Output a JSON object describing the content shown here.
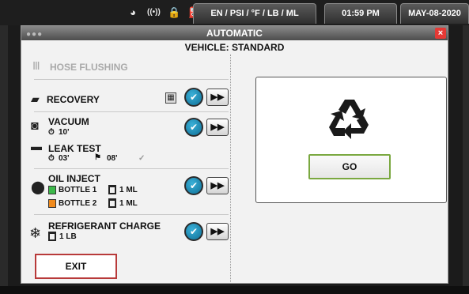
{
  "status_bar": {
    "icons": [
      "gauge-icon",
      "wifi-icon",
      "lock-icon",
      "tank-icon",
      "scale-icon"
    ],
    "units": "EN / PSI / °F / LB / ML",
    "time": "01:59 PM",
    "date": "MAY-08-2020"
  },
  "window": {
    "title": "AUTOMATIC",
    "close_label": "×",
    "vehicle": "VEHICLE: STANDARD"
  },
  "steps": {
    "hose_flushing": {
      "label": "HOSE FLUSHING",
      "disabled": true
    },
    "recovery": {
      "label": "RECOVERY"
    },
    "vacuum": {
      "label": "VACUUM",
      "time": "10'"
    },
    "leak_test": {
      "label": "LEAK TEST",
      "time": "03'",
      "flag_time": "08'"
    },
    "oil_inject": {
      "label": "OIL INJECT",
      "bottle1": {
        "label": "BOTTLE 1",
        "amount": "1 ML",
        "color": "#3cb94a"
      },
      "bottle2": {
        "label": "BOTTLE 2",
        "amount": "1 ML",
        "color": "#f08a1c"
      }
    },
    "refrigerant": {
      "label": "REFRIGERANT CHARGE",
      "amount": "1 LB"
    }
  },
  "buttons": {
    "check_glyph": "✔",
    "skip_glyph": "▶▶",
    "go": "GO",
    "exit": "EXIT"
  },
  "colors": {
    "accent_blue": "#1a8dbb",
    "go_border": "#7aa840",
    "exit_border": "#b83a3a",
    "close_red": "#e53935"
  }
}
